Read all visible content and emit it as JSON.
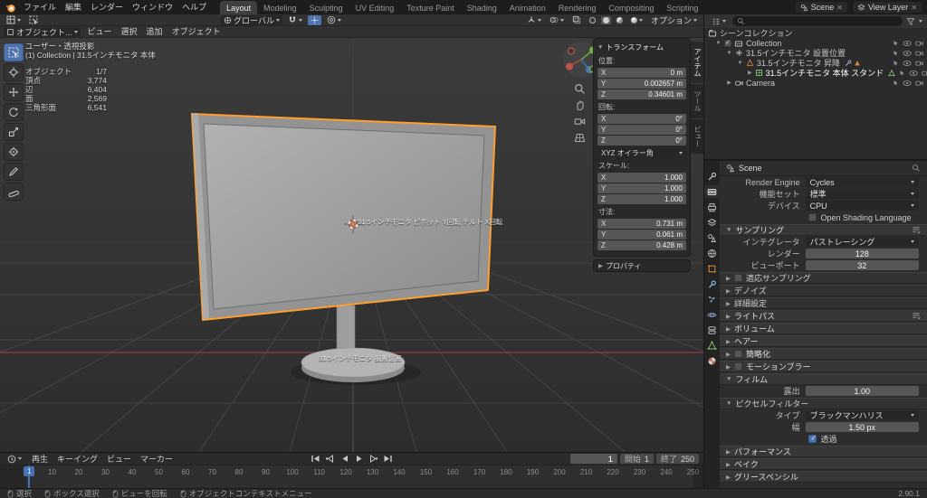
{
  "topbar": {
    "menus": [
      "ファイル",
      "編集",
      "レンダー",
      "ウィンドウ",
      "ヘルプ"
    ],
    "workspaces": [
      "Layout",
      "Modeling",
      "Sculpting",
      "UV Editing",
      "Texture Paint",
      "Shading",
      "Animation",
      "Rendering",
      "Compositing",
      "Scripting"
    ],
    "active_workspace": "Layout",
    "scene": {
      "label": "Scene"
    },
    "view_layer": {
      "label": "View Layer"
    }
  },
  "viewport": {
    "header": {
      "mode": "オブジェクト...",
      "menus": [
        "ビュー",
        "選択",
        "追加",
        "オブジェクト"
      ],
      "orientation": "グローバル",
      "options": "オプション"
    },
    "overlay": {
      "view": "ユーザー・透視投影",
      "context": "(1) Collection | 31.5インチモニタ 本体",
      "stats": [
        {
          "label": "オブジェクト",
          "value": "1/7"
        },
        {
          "label": "頂点",
          "value": "3,774"
        },
        {
          "label": "辺",
          "value": "6,404"
        },
        {
          "label": "面",
          "value": "2,569"
        },
        {
          "label": "三角形面",
          "value": "6,541"
        }
      ]
    },
    "labels": {
      "pivot": "31.5インチモニタ ピボット Y回転  チルト X回転",
      "base": "31.5インチモニタ 設置位置"
    }
  },
  "sidebar": {
    "title": "トランスフォーム",
    "tabs": [
      "アイテム",
      "ツール",
      "ビュー"
    ],
    "active_tab": "アイテム",
    "location": {
      "title": "位置:",
      "rows": [
        {
          "axis": "X",
          "value": "0 m"
        },
        {
          "axis": "Y",
          "value": "0.002657 m"
        },
        {
          "axis": "Z",
          "value": "0.34601 m"
        }
      ]
    },
    "rotation": {
      "title": "回転:",
      "rows": [
        {
          "axis": "X",
          "value": "0°"
        },
        {
          "axis": "Y",
          "value": "0°"
        },
        {
          "axis": "Z",
          "value": "0°"
        }
      ]
    },
    "rotation_mode": "XYZ オイラー角",
    "scale": {
      "title": "スケール:",
      "rows": [
        {
          "axis": "X",
          "value": "1.000"
        },
        {
          "axis": "Y",
          "value": "1.000"
        },
        {
          "axis": "Z",
          "value": "1.000"
        }
      ]
    },
    "dimensions": {
      "title": "寸法:",
      "rows": [
        {
          "axis": "X",
          "value": "0.731 m"
        },
        {
          "axis": "Y",
          "value": "0.061 m"
        },
        {
          "axis": "Z",
          "value": "0.428 m"
        }
      ]
    },
    "properties_label": "プロパティ"
  },
  "outliner": {
    "scene_collection": "シーンコレクション",
    "rows": [
      {
        "label": "Collection"
      },
      {
        "label": "31.5インチモニタ 設置位置"
      },
      {
        "label": "31.5インチモニタ 昇降"
      },
      {
        "label": "31.5インチモニタ 本体 スタンド"
      },
      {
        "label": "Camera"
      }
    ]
  },
  "properties": {
    "breadcrumb": "Scene",
    "render_engine": {
      "label": "Render Engine",
      "value": "Cycles"
    },
    "feature_set": {
      "label": "機能セット",
      "value": "標準"
    },
    "device": {
      "label": "デバイス",
      "value": "CPU"
    },
    "osl": {
      "label": "Open Shading Language"
    },
    "sampling": {
      "title": "サンプリング",
      "integrator": {
        "label": "インテグレータ",
        "value": "パストレーシング"
      },
      "render": {
        "label": "レンダー",
        "value": "128"
      },
      "viewport": {
        "label": "ビューポート",
        "value": "32"
      },
      "adaptive": "適応サンプリング",
      "denoise": "デノイズ",
      "advanced": "詳細設定"
    },
    "light_paths": "ライトパス",
    "volumes": "ボリューム",
    "hair": "ヘアー",
    "simplify": "簡略化",
    "motion_blur": "モーションブラー",
    "film": {
      "title": "フィルム",
      "exposure": {
        "label": "露出",
        "value": "1.00"
      },
      "pixel_filter_title": "ピクセルフィルター",
      "filter_type": {
        "label": "タイプ",
        "value": "ブラックマンハリス"
      },
      "width": {
        "label": "幅",
        "value": "1.50 px"
      },
      "transparent": "透過"
    },
    "performance": "パフォーマンス",
    "bake": "ベイク",
    "grease_pencil": "グリースペンシル"
  },
  "timeline": {
    "menus": [
      "再生",
      "キーイング",
      "ビュー",
      "マーカー"
    ],
    "current_frame": "1",
    "start": {
      "label": "開始",
      "value": "1"
    },
    "end": {
      "label": "終了",
      "value": "250"
    },
    "ticks": [
      0,
      10,
      20,
      30,
      40,
      50,
      60,
      70,
      80,
      90,
      100,
      110,
      120,
      130,
      140,
      150,
      160,
      170,
      180,
      190,
      200,
      210,
      220,
      230,
      240,
      250
    ],
    "playhead": "1"
  },
  "statusbar": {
    "hints": [
      "選択",
      "ボックス選択",
      "ビューを回転",
      "オブジェクトコンテキストメニュー"
    ],
    "version": "2.90.1"
  },
  "colors": {
    "accent": "#4772b3",
    "selection_outline": "#ff9e2c",
    "axis_x": "#b04a43",
    "axis_y": "#6fa83d",
    "axis_z": "#3d6fb8"
  }
}
